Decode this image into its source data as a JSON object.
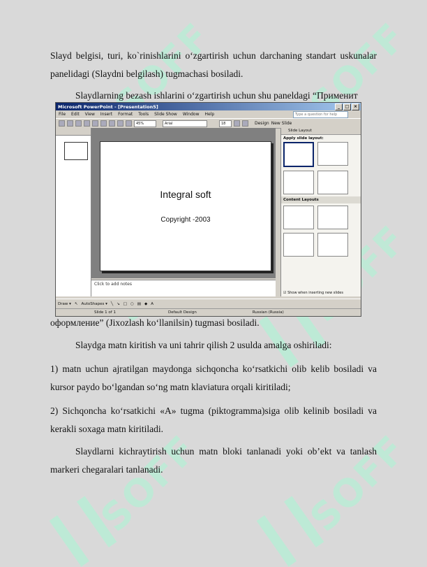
{
  "paragraphs": {
    "p1": "Slayd belgisi, turi, ko`rinishlarini o‘zgartirish uchun darchaning standart uskunalar panelidagi (Slaydni belgilash) tugmachasi bosiladi.",
    "p2": "Slaydlarning bezash ishlarini o‘zgartirish uchun shu paneldagi “Применит",
    "p3": "оформление” (Jixozlash ko‘llanilsin) tugmasi bosiladi.",
    "p4": "Slaydga matn kiritish va uni tahrir qilish 2 usulda amalga oshiriladi:",
    "p5": "1) matn uchun ajratilgan maydonga sichqoncha ko‘rsatkichi olib kelib bosiladi va kursor paydo bo‘lgandan so‘ng matn klaviatura orqali kiritiladi;",
    "p6": "2) Sichqoncha ko‘rsatkichi «A» tugma (piktogramma)siga olib kelinib bosiladi va kerakli soxaga matn kiritiladi.",
    "p7": "Slaydlarni kichraytirish uchun matn bloki tanlanadi yoki ob’ekt va tanlash markeri chegaralari tanlanadi."
  },
  "screenshot": {
    "window_title": "Microsoft PowerPoint - [Presentation5]",
    "menu": [
      "File",
      "Edit",
      "View",
      "Insert",
      "Format",
      "Tools",
      "Slide Show",
      "Window",
      "Help"
    ],
    "help_placeholder": "Type a question for help",
    "zoom": "45%",
    "font": "Arial",
    "font_size": "18",
    "design_btn": "Design",
    "new_slide_btn": "New Slide",
    "slide_title": "Integral soft",
    "slide_subtitle": "Copyright -2003",
    "notes_placeholder": "Click to add notes",
    "taskpane_title": "Slide Layout",
    "apply_label": "Apply slide layout:",
    "content_layouts": "Content Layouts",
    "show_when": "Show when inserting new slides",
    "draw_label": "Draw ▾",
    "autoshapes_label": "AutoShapes ▾",
    "status_slide": "Slide 1 of 1",
    "status_design": "Default Design",
    "status_lang": "Russian (Russia)"
  },
  "watermark": "SOFF"
}
